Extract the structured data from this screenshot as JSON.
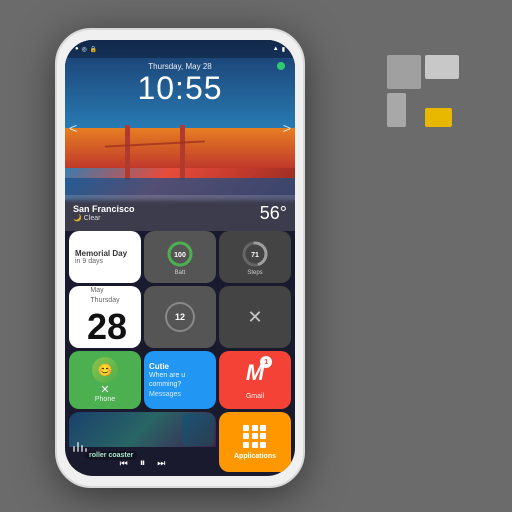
{
  "background_color": "#6b6b6b",
  "logo": {
    "blocks": [
      "gray-large",
      "gray-small-top",
      "gray-small-bottom",
      "yellow"
    ]
  },
  "phone": {
    "status_bar": {
      "left_icons": [
        "signal",
        "wifi",
        "lock"
      ],
      "right_icons": [
        "signal-bars",
        "battery"
      ],
      "time": ""
    },
    "hero": {
      "date": "Thursday, May 28",
      "time": "10:55",
      "location": "Golden Gate Bridge"
    },
    "weather": {
      "city": "San Francisco",
      "condition": "Clear",
      "temperature": "56°"
    },
    "navigation": {
      "left": "<",
      "right": ">"
    },
    "widgets": {
      "memorial": {
        "title": "Memorial Day",
        "subtitle": "in 9 days"
      },
      "battery": {
        "value": "100",
        "label": "Battery"
      },
      "steps": {
        "value": "71",
        "label": "Steps"
      },
      "calendar": {
        "month": "May",
        "day_name": "Thursday",
        "day_number": "28"
      },
      "date_ring": {
        "value": "12"
      },
      "phone_widget": {
        "label": "Phone"
      },
      "messages": {
        "contact": "Cutie",
        "preview": "When are u comming?",
        "label": "Messages"
      },
      "gmail": {
        "label": "Gmail",
        "badge": "1"
      },
      "music": {
        "song": "roller coaster",
        "controls": [
          "prev",
          "play",
          "next"
        ]
      },
      "applications": {
        "label": "Applications"
      }
    }
  }
}
